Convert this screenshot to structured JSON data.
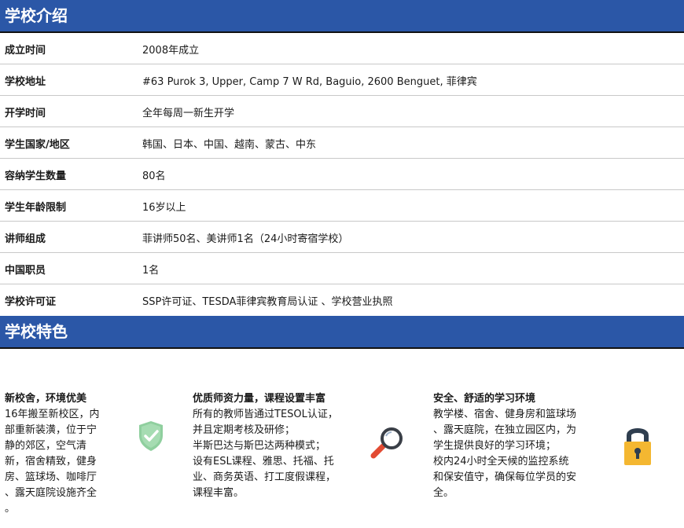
{
  "section1": {
    "title": "学校介绍"
  },
  "info": [
    {
      "label": "成立时间",
      "value": "2008年成立"
    },
    {
      "label": "学校地址",
      "value": "#63 Purok 3, Upper, Camp 7 W Rd, Baguio, 2600 Benguet, 菲律宾"
    },
    {
      "label": "开学时间",
      "value": "全年每周一新生开学"
    },
    {
      "label": "学生国家/地区",
      "value": "韩国、日本、中国、越南、蒙古、中东"
    },
    {
      "label": "容纳学生数量",
      "value": "80名"
    },
    {
      "label": "学生年龄限制",
      "value": "16岁以上"
    },
    {
      "label": "讲师组成",
      "value": "菲讲师50名、美讲师1名（24小时寄宿学校）"
    },
    {
      "label": "中国职员",
      "value": "1名"
    },
    {
      "label": "学校许可证",
      "value": "SSP许可证、TESDA菲律宾教育局认证 、学校营业执照"
    }
  ],
  "section2": {
    "title": "学校特色"
  },
  "features": [
    {
      "title": "新校舍，环境优美",
      "lines": [
        "16年搬至新校区，内",
        "部重新装潢，位于宁",
        "静的郊区，空气清",
        "新，宿舍精致，健身",
        "房、篮球场、咖啡厅",
        "、露天庭院设施齐全",
        "。"
      ],
      "icon": "shield-check-icon"
    },
    {
      "title": "优质师资力量，课程设置丰富",
      "lines": [
        "所有的教师皆通过TESOL认证，",
        "并且定期考核及研修；",
        "半斯巴达与斯巴达两种模式；",
        "设有ESL课程、雅思、托福、托",
        "业、商务英语、打工度假课程，",
        "课程丰富。"
      ],
      "icon": "magnifier-icon"
    },
    {
      "title": "安全、舒适的学习环境",
      "lines": [
        "教学楼、宿舍、健身房和篮球场",
        "、露天庭院，在独立园区内，为",
        "学生提供良好的学习环境；",
        "校内24小时全天候的监控系统",
        "和保安值守，确保每位学员的安",
        "全。"
      ],
      "icon": "padlock-icon"
    }
  ],
  "colors": {
    "header_bg": "#2b57a7",
    "shield": "#8fcf9e",
    "lock_body": "#f4b731",
    "lock_shackle": "#2f3e4f",
    "magnifier_handle": "#e24b33"
  }
}
